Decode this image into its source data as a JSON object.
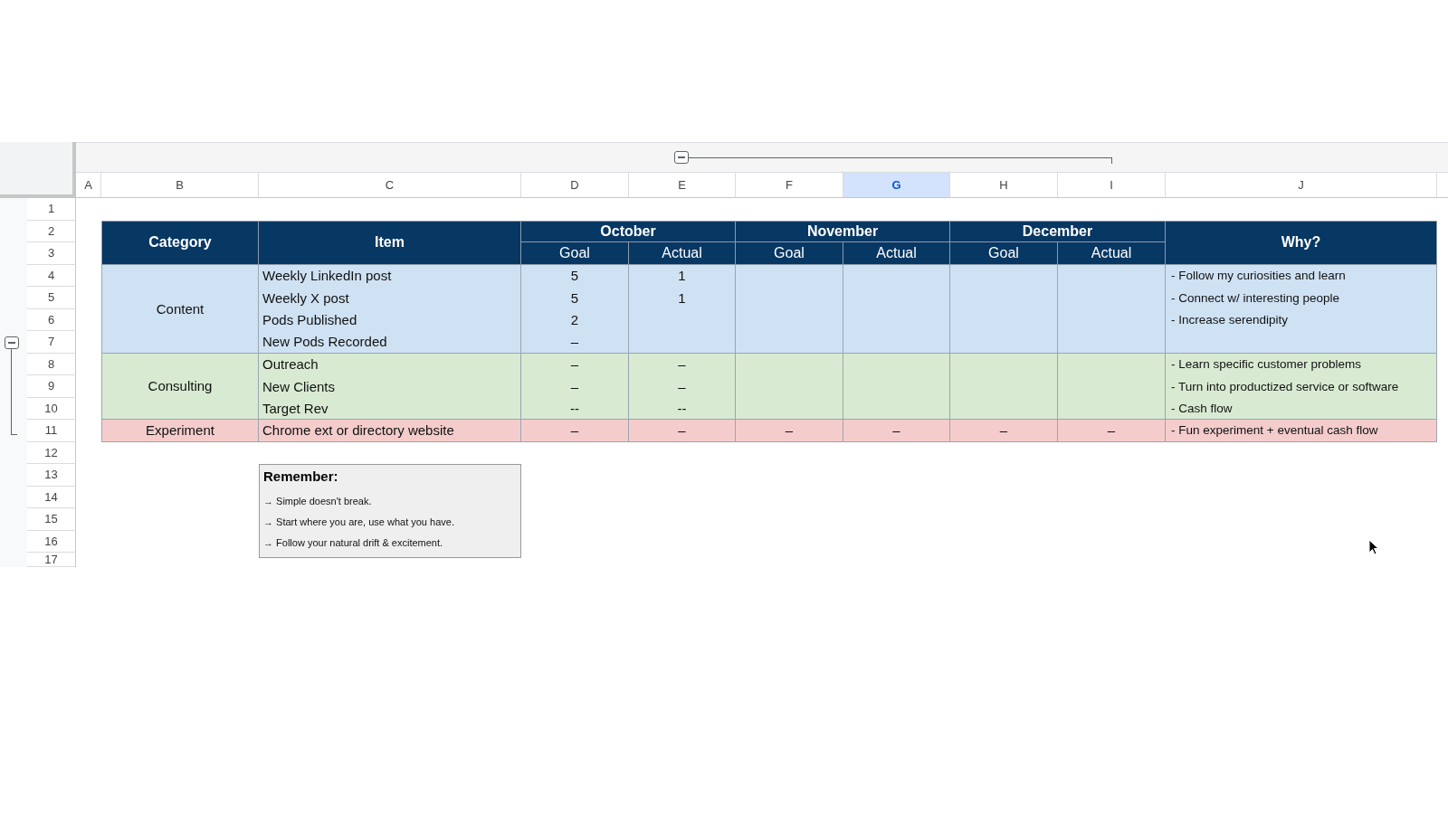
{
  "columns": [
    {
      "label": "A",
      "selected": false
    },
    {
      "label": "B",
      "selected": false
    },
    {
      "label": "C",
      "selected": false
    },
    {
      "label": "D",
      "selected": false
    },
    {
      "label": "E",
      "selected": false
    },
    {
      "label": "F",
      "selected": false
    },
    {
      "label": "G",
      "selected": true
    },
    {
      "label": "H",
      "selected": false
    },
    {
      "label": "I",
      "selected": false
    },
    {
      "label": "J",
      "selected": false
    }
  ],
  "rows": [
    "1",
    "2",
    "3",
    "4",
    "5",
    "6",
    "7",
    "8",
    "9",
    "10",
    "11",
    "12",
    "13",
    "14",
    "15",
    "16",
    "17"
  ],
  "table": {
    "header": {
      "category": "Category",
      "item": "Item",
      "months": [
        {
          "name": "October",
          "subcolumns": [
            "Goal",
            "Actual"
          ]
        },
        {
          "name": "November",
          "subcolumns": [
            "Goal",
            "Actual"
          ]
        },
        {
          "name": "December",
          "subcolumns": [
            "Goal",
            "Actual"
          ]
        }
      ],
      "why": "Why?"
    },
    "groups": [
      {
        "category": "Content",
        "color": "#cfe2f3",
        "rows": [
          {
            "item": "Weekly LinkedIn post",
            "values": {
              "D": "5",
              "E": "1"
            },
            "why": "- Follow my curiosities and learn"
          },
          {
            "item": "Weekly X post",
            "values": {
              "D": "5",
              "E": "1"
            },
            "why": "- Connect w/ interesting people"
          },
          {
            "item": "Pods Published",
            "values": {
              "D": "2"
            },
            "why": "- Increase serendipity"
          },
          {
            "item": "New Pods Recorded",
            "values": {
              "D": "–"
            }
          }
        ]
      },
      {
        "category": "Consulting",
        "color": "#d9ead3",
        "rows": [
          {
            "item": "Outreach",
            "values": {
              "D": "–",
              "E": "–"
            },
            "why": "- Learn specific customer problems"
          },
          {
            "item": "New Clients",
            "values": {
              "D": "–",
              "E": "–"
            },
            "why": "- Turn into productized service or software"
          },
          {
            "item": "Target Rev",
            "values": {
              "D": "--",
              "E": "--"
            },
            "why": "- Cash flow"
          }
        ]
      },
      {
        "category": "Experiment",
        "color": "#f4cccc",
        "rows": [
          {
            "item": "Chrome ext or directory website",
            "values": {
              "D": "–",
              "E": "–",
              "F": "–",
              "G": "–",
              "H": "–",
              "I": "–"
            },
            "why": "- Fun experiment + eventual cash flow"
          }
        ]
      }
    ]
  },
  "note": {
    "title": "Remember:",
    "lines": [
      "→ Simple doesn't break.",
      "→ Start where you are, use what you have.",
      "→ Follow your natural drift & excitement."
    ]
  }
}
